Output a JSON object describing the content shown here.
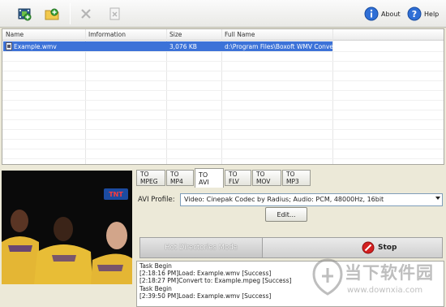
{
  "toolbar": {
    "buttons": [
      {
        "name": "add-video-icon"
      },
      {
        "name": "add-folder-icon"
      },
      {
        "name": "remove-icon"
      },
      {
        "name": "clear-icon"
      }
    ],
    "about_label": "About",
    "help_label": "Help"
  },
  "file_list": {
    "columns": [
      "Name",
      "Imformation",
      "Size",
      "Full Name"
    ],
    "rows": [
      {
        "name": "Example.wmv",
        "information": "",
        "size": "3,076 KB",
        "full_name": "d:\\Program Files\\Boxoft WMV Conve..."
      }
    ]
  },
  "video": {
    "channel_logo": "TNT"
  },
  "format_tabs": [
    {
      "label": "TO MPEG",
      "active": false
    },
    {
      "label": "TO MP4",
      "active": false
    },
    {
      "label": "TO AVI",
      "active": true
    },
    {
      "label": "TO FLV",
      "active": false
    },
    {
      "label": "TO MOV",
      "active": false
    },
    {
      "label": "TO MP3",
      "active": false
    }
  ],
  "profile": {
    "label": "AVI Profile:",
    "value": "Video: Cinepak Codec by Radius; Audio: PCM, 48000Hz, 16bit"
  },
  "edit_label": "Edit...",
  "hot_directories_label": "Hot Directories Mode",
  "stop_label": "Stop",
  "log_lines": [
    "Task Begin",
    "[2:18:16 PM]Load: Example.wmv [Success]",
    "[2:18:27 PM]Convert to: Example.mpeg [Success]",
    "Task Begin",
    "[2:39:50 PM]Load: Example.wmv [Success]"
  ],
  "watermark": {
    "text": "当下软件园",
    "url": "www.downxia.com"
  },
  "colors": {
    "selection": "#3c72d8",
    "stop_red": "#d42020",
    "help_blue": "#2f6fd6"
  }
}
